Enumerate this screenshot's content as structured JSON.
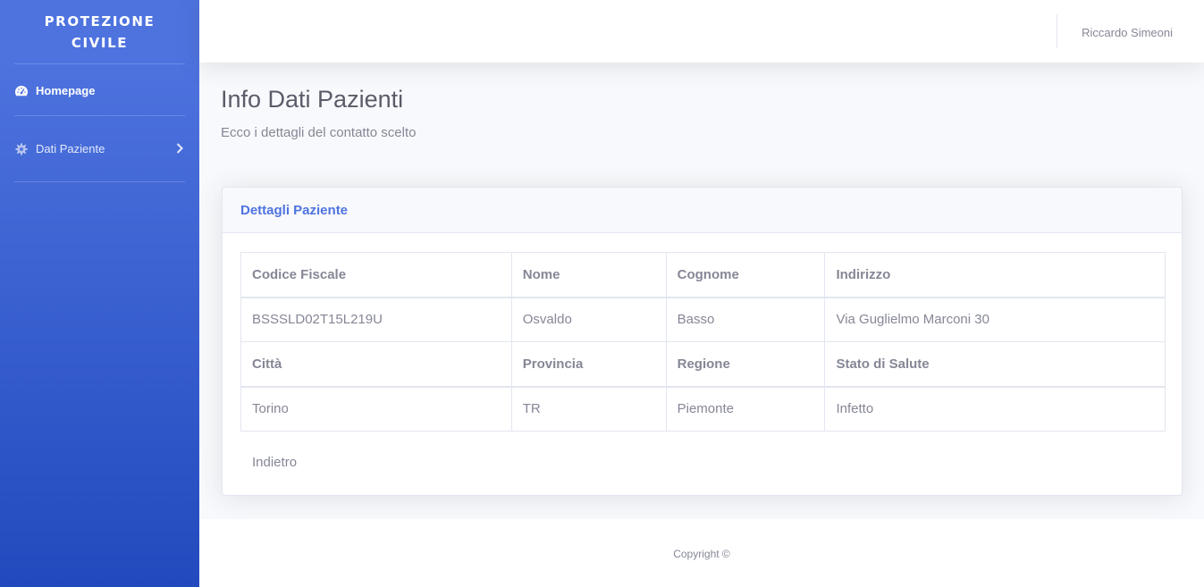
{
  "sidebar": {
    "brand_line1": "PROTEZIONE",
    "brand_line2": "CIVILE",
    "items": [
      {
        "label": "Homepage",
        "icon": "tachometer-icon"
      },
      {
        "label": "Dati Paziente",
        "icon": "gear-icon"
      }
    ]
  },
  "topbar": {
    "user_name": "Riccardo Simeoni"
  },
  "page": {
    "title": "Info Dati Pazienti",
    "subtitle": "Ecco i dettagli del contatto scelto"
  },
  "card": {
    "header": "Dettagli Paziente",
    "rows": [
      [
        "Codice Fiscale",
        "Nome",
        "Cognome",
        "Indirizzo"
      ],
      [
        "BSSSLD02T15L219U",
        "Osvaldo",
        "Basso",
        "Via Guglielmo Marconi 30"
      ],
      [
        "Città",
        "Provincia",
        "Regione",
        "Stato di Salute"
      ],
      [
        "Torino",
        "TR",
        "Piemonte",
        "Infetto"
      ]
    ],
    "back_label": "Indietro"
  },
  "footer": {
    "copyright": "Copyright ©"
  },
  "colors": {
    "primary": "#4e73df",
    "primary_dark": "#224abe",
    "text": "#858796",
    "heading": "#5a5c69"
  }
}
